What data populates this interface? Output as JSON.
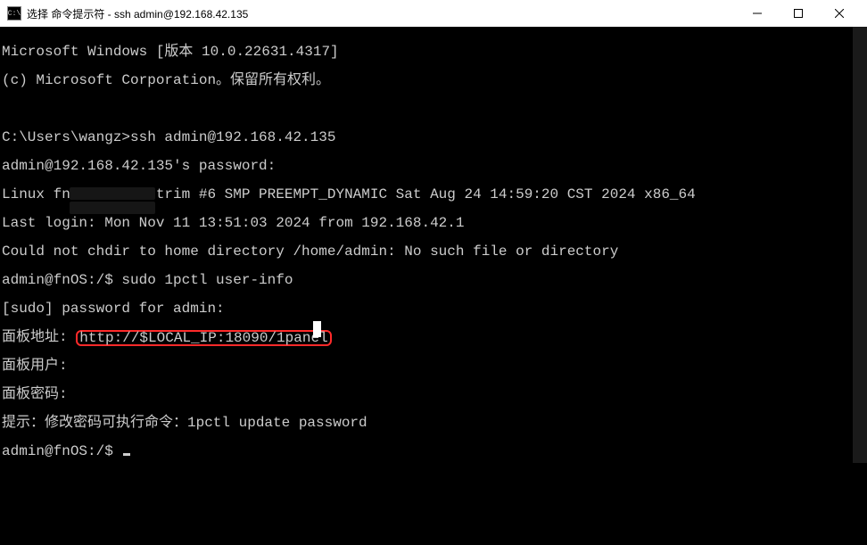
{
  "window": {
    "icon_label": "C:\\",
    "title": "选择 命令提示符 - ssh  admin@192.168.42.135"
  },
  "terminal": {
    "lines": {
      "l1": "Microsoft Windows [版本 10.0.22631.4317]",
      "l2": "(c) Microsoft Corporation。保留所有权利。",
      "l3": "",
      "l4": "C:\\Users\\wangz>ssh admin@192.168.42.135",
      "l5": "admin@192.168.42.135's password:",
      "l6": "Linux fnOS 6.6.38-trim #6 SMP PREEMPT_DYNAMIC Sat Aug 24 14:59:20 CST 2024 x86_64",
      "l7": "Last login: Mon Nov 11 13:51:03 2024 from 192.168.42.1",
      "l8": "Could not chdir to home directory /home/admin: No such file or directory",
      "l9": "admin@fnOS:/$ sudo 1pctl user-info",
      "l10": "[sudo] password for admin:",
      "l11_prefix": "面板地址: ",
      "l11_highlight": "http://$LOCAL_IP:18090/1panel",
      "l12": "面板用户: ",
      "l13": "面板密码: ",
      "l14": "提示：修改密码可执行命令：1pctl update password",
      "l15": "admin@fnOS:/$ "
    }
  }
}
